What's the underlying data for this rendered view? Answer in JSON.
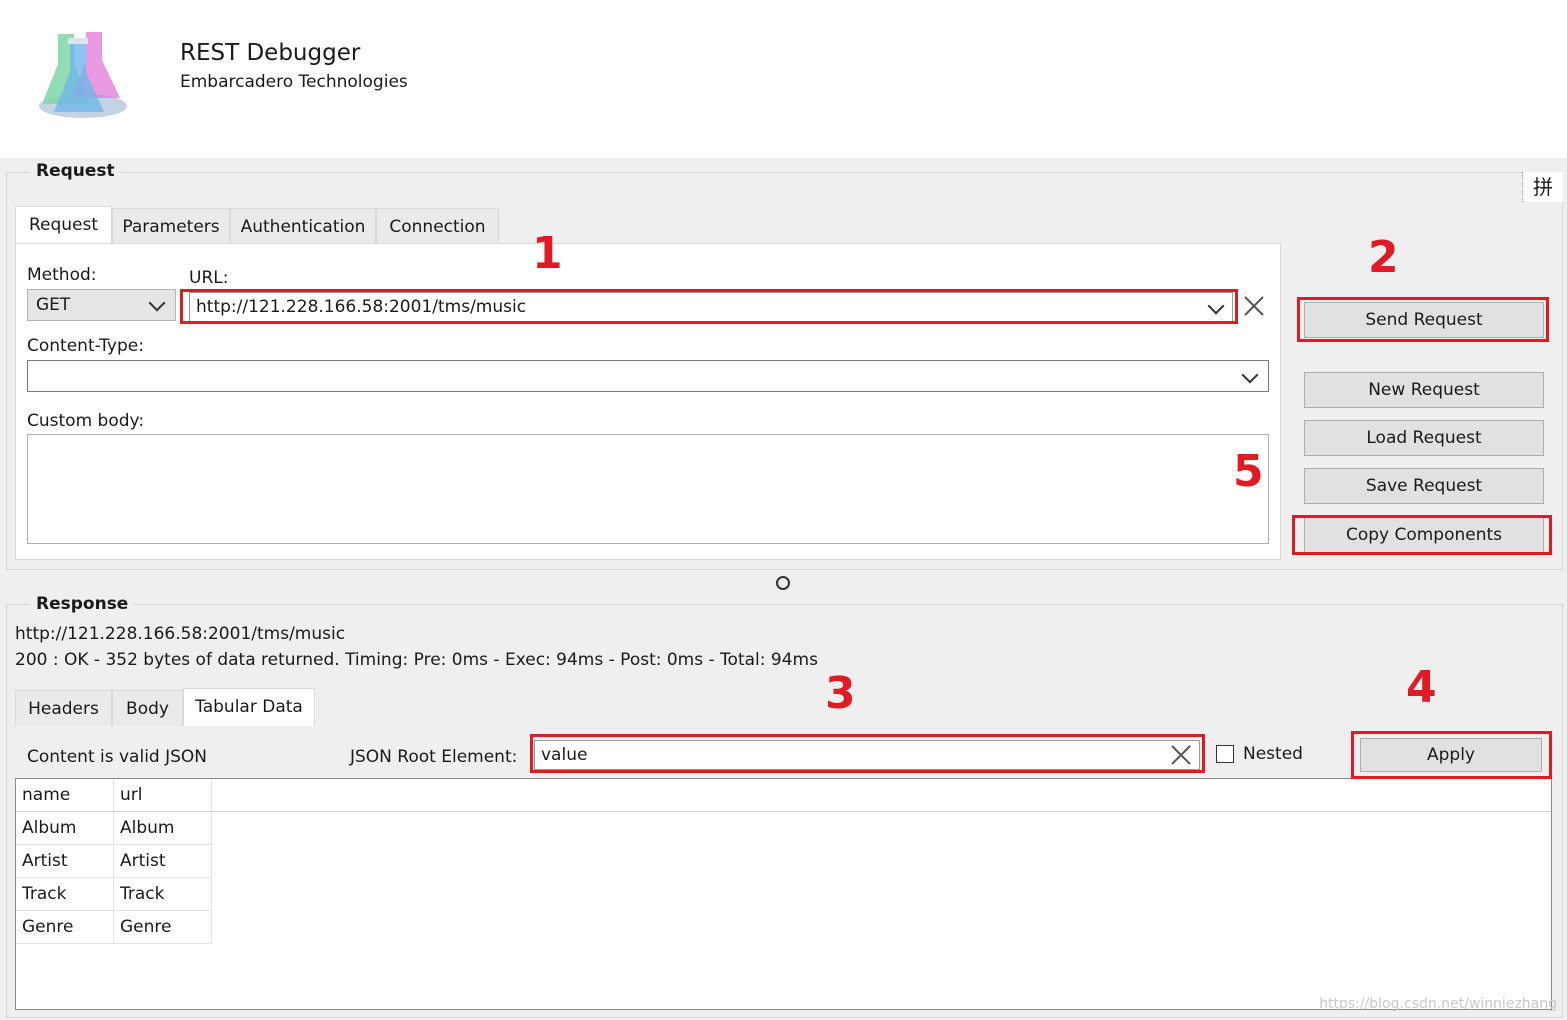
{
  "app": {
    "title": "REST Debugger",
    "subtitle": "Embarcadero Technologies"
  },
  "request": {
    "group_title": "Request",
    "tabs": [
      "Request",
      "Parameters",
      "Authentication",
      "Connection"
    ],
    "method_label": "Method:",
    "method_value": "GET",
    "url_label": "URL:",
    "url_value": "http://121.228.166.58:2001/tms/music",
    "content_type_label": "Content-Type:",
    "content_type_value": "",
    "custom_body_label": "Custom body:",
    "custom_body_value": ""
  },
  "actions": {
    "send": "Send Request",
    "new": "New Request",
    "load": "Load Request",
    "save": "Save Request",
    "copy": "Copy Components"
  },
  "response": {
    "group_title": "Response",
    "url": "http://121.228.166.58:2001/tms/music",
    "status": "200 : OK - 352 bytes of data returned. Timing: Pre: 0ms - Exec: 94ms - Post: 0ms - Total: 94ms",
    "tabs": [
      "Headers",
      "Body",
      "Tabular Data"
    ],
    "valid_json": "Content is valid JSON",
    "root_label": "JSON Root Element:",
    "root_value": "value",
    "nested_label": "Nested",
    "nested_checked": false,
    "apply": "Apply",
    "columns": [
      "name",
      "url"
    ],
    "rows": [
      [
        "Album",
        "Album"
      ],
      [
        "Artist",
        "Artist"
      ],
      [
        "Track",
        "Track"
      ],
      [
        "Genre",
        "Genre"
      ]
    ]
  },
  "markers": [
    "1",
    "2",
    "3",
    "4",
    "5"
  ],
  "ime_glyph": "拼",
  "watermark": "https://blog.csdn.net/winniezhang",
  "colors": {
    "annotation_red": "#e01b24",
    "panel_bg": "#efefef",
    "button_bg": "#e1e1e1"
  },
  "icons": {
    "logo": "flask-logo-icon",
    "clear": "close-icon",
    "dropdown": "chevron-down-icon",
    "splitter": "splitter-handle-icon"
  }
}
